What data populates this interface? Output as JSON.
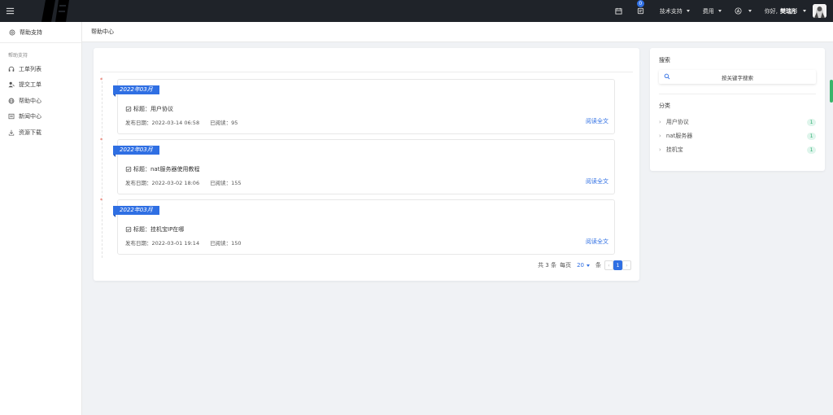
{
  "topbar": {
    "badge_count": "0",
    "tech_support": "技术支持",
    "billing": "费用",
    "greeting": "你好,",
    "username": "樊瑞彤"
  },
  "sidebar": {
    "title": "帮助支持",
    "group": "帮助支持",
    "items": [
      {
        "label": "工单列表",
        "icon": "headset-icon"
      },
      {
        "label": "提交工单",
        "icon": "user-edit-icon"
      },
      {
        "label": "帮助中心",
        "icon": "globe-icon"
      },
      {
        "label": "新闻中心",
        "icon": "news-icon"
      },
      {
        "label": "资源下载",
        "icon": "download-icon"
      }
    ]
  },
  "breadcrumb": "帮助中心",
  "articles": [
    {
      "month": "2022年03月",
      "title": "标题：用户协议",
      "date": "发布日期：2022-03-14 06:58",
      "reads": "已阅读：95",
      "link": "阅读全文"
    },
    {
      "month": "2022年03月",
      "title": "标题：nat服务器使用教程",
      "date": "发布日期：2022-03-02 18:06",
      "reads": "已阅读：155",
      "link": "阅读全文"
    },
    {
      "month": "2022年03月",
      "title": "标题：挂机宝IP在哪",
      "date": "发布日期：2022-03-01 19:14",
      "reads": "已阅读：150",
      "link": "阅读全文"
    }
  ],
  "pagination": {
    "total": "共 3 条",
    "per_page_label": "每页",
    "per_page": "20",
    "unit": "条",
    "current": "1",
    "prev": "‹",
    "next": "›"
  },
  "side": {
    "search_title": "搜索",
    "search_button": "按关键字搜索",
    "category_title": "分类",
    "categories": [
      {
        "name": "用户协议",
        "count": "1"
      },
      {
        "name": "nat服务器",
        "count": "1"
      },
      {
        "name": "挂机宝",
        "count": "1"
      }
    ]
  },
  "colors": {
    "accent": "#2f6fe3",
    "topbar": "#1f2329",
    "count_badge": "#2fae72"
  }
}
